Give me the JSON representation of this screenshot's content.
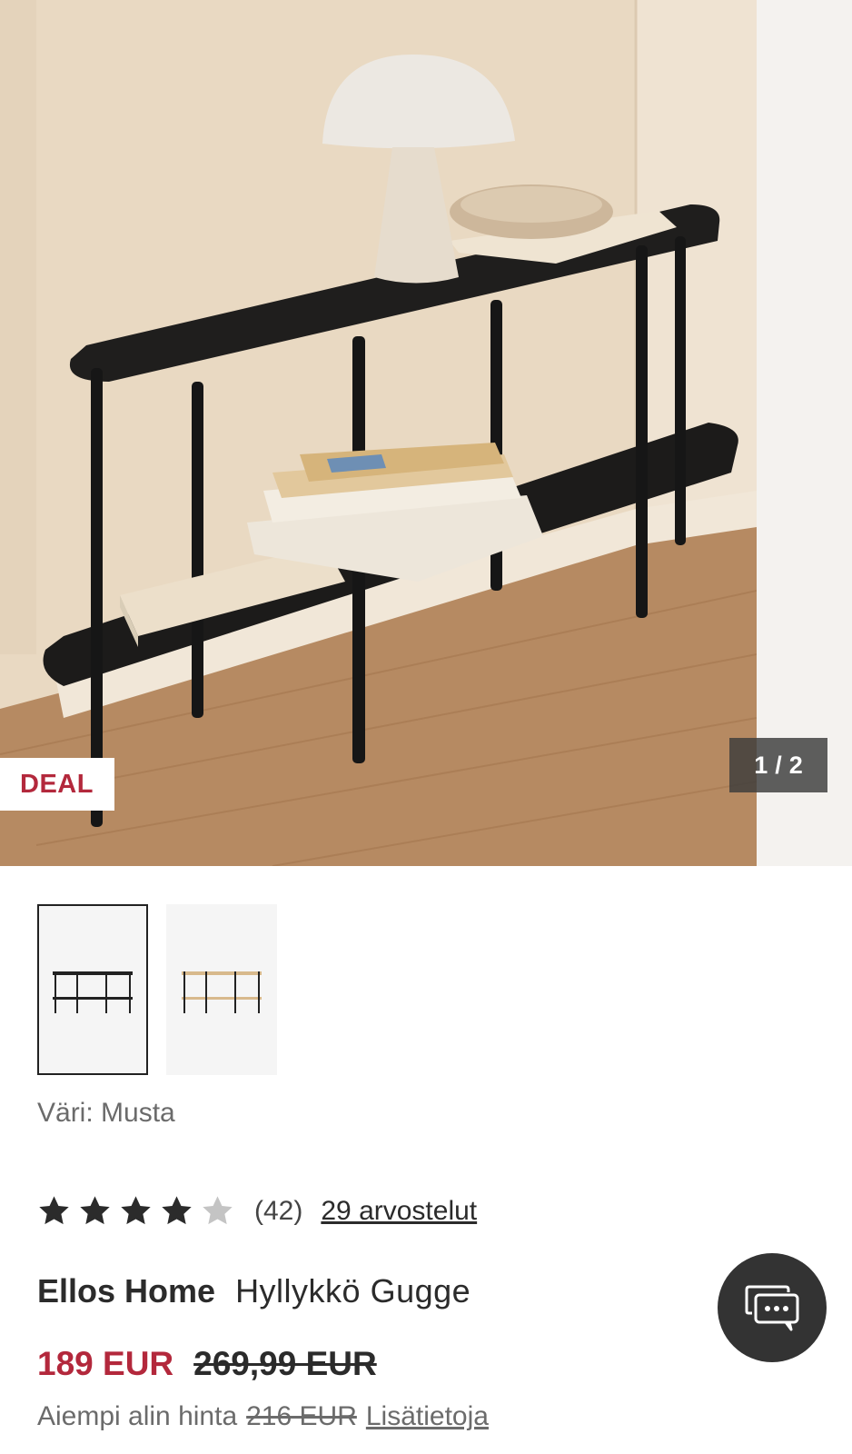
{
  "gallery": {
    "counter_current": "1",
    "counter_separator": "/",
    "counter_total": "2",
    "badge": "DEAL",
    "image_alt": "Hyllykkö Gugge musta"
  },
  "thumbnails": [
    {
      "name": "thumbnail-black",
      "selected": true,
      "color": "#222222"
    },
    {
      "name": "thumbnail-oak",
      "selected": false,
      "color": "#d8b98c"
    }
  ],
  "color": {
    "label": "Väri: Musta"
  },
  "rating": {
    "stars_filled": 4,
    "stars_total": 5,
    "count_text": "(42)",
    "reviews_text": "29 arvostelut"
  },
  "product": {
    "brand": "Ellos Home",
    "name": "Hyllykkö Gugge"
  },
  "price": {
    "current": "189 EUR",
    "previous": "269,99 EUR"
  },
  "lowest": {
    "label": "Aiempi alin hinta",
    "price": "216 EUR",
    "link": "Lisätietoja"
  },
  "colors": {
    "accent_red": "#b3283c",
    "chat_bg": "#333333",
    "star_filled": "#2b2b2b",
    "star_empty": "#c4c4c4"
  }
}
